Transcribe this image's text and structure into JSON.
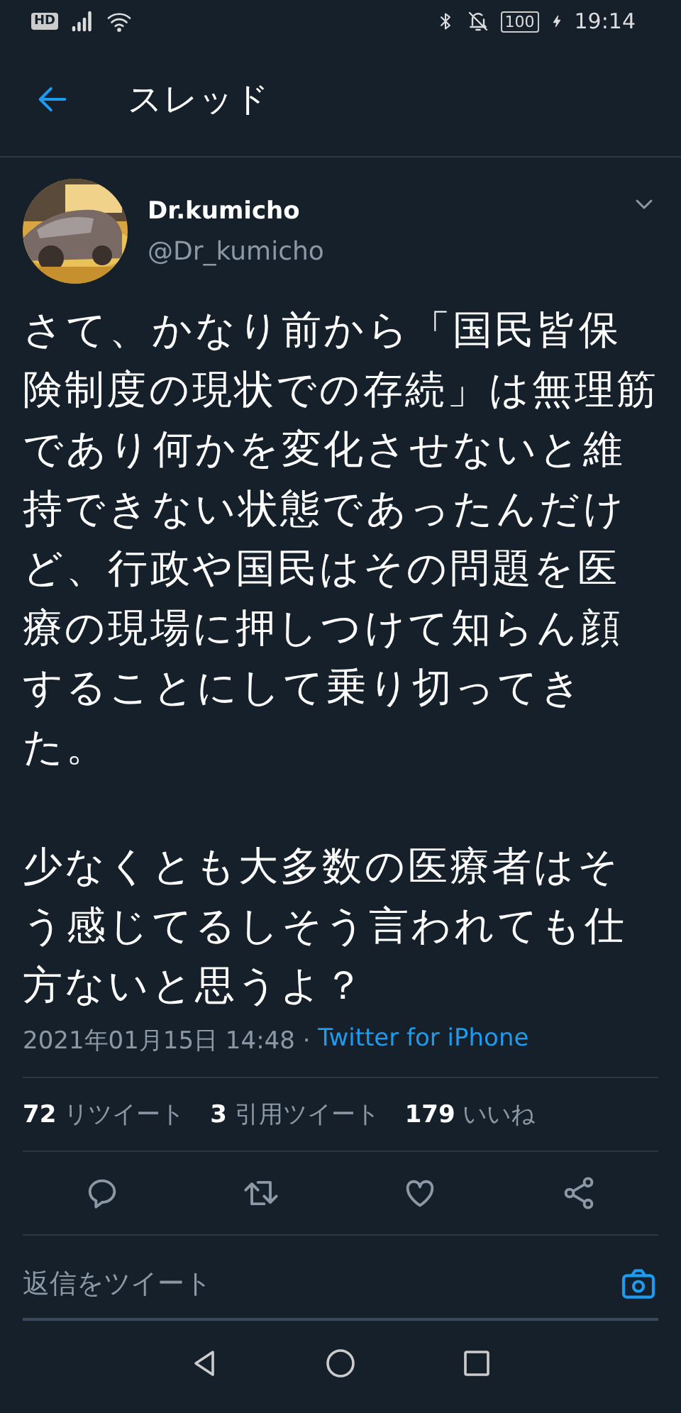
{
  "status_bar": {
    "network": "HD",
    "battery": "100",
    "time": "19:14"
  },
  "header": {
    "title": "スレッド"
  },
  "tweet": {
    "name": "Dr.kumicho",
    "handle": "@Dr_kumicho",
    "paragraphs": [
      "さて、かなり前から「国民皆保険制度の現状での存続」は無理筋であり何かを変化させないと維持できない状態であったんだけど、行政や国民はその問題を医療の現場に押しつけて知らん顔することにして乗り切ってきた。",
      "少なくとも大多数の医療者はそう感じてるしそう言われても仕方ないと思うよ？"
    ],
    "timestamp": "2021年01月15日 14:48 · ",
    "source": "Twitter for iPhone",
    "stats": [
      "**72** リツイート",
      "**3** 引用ツイート",
      "**179** いいね"
    ]
  },
  "reply": {
    "placeholder": "返信をツイート"
  }
}
